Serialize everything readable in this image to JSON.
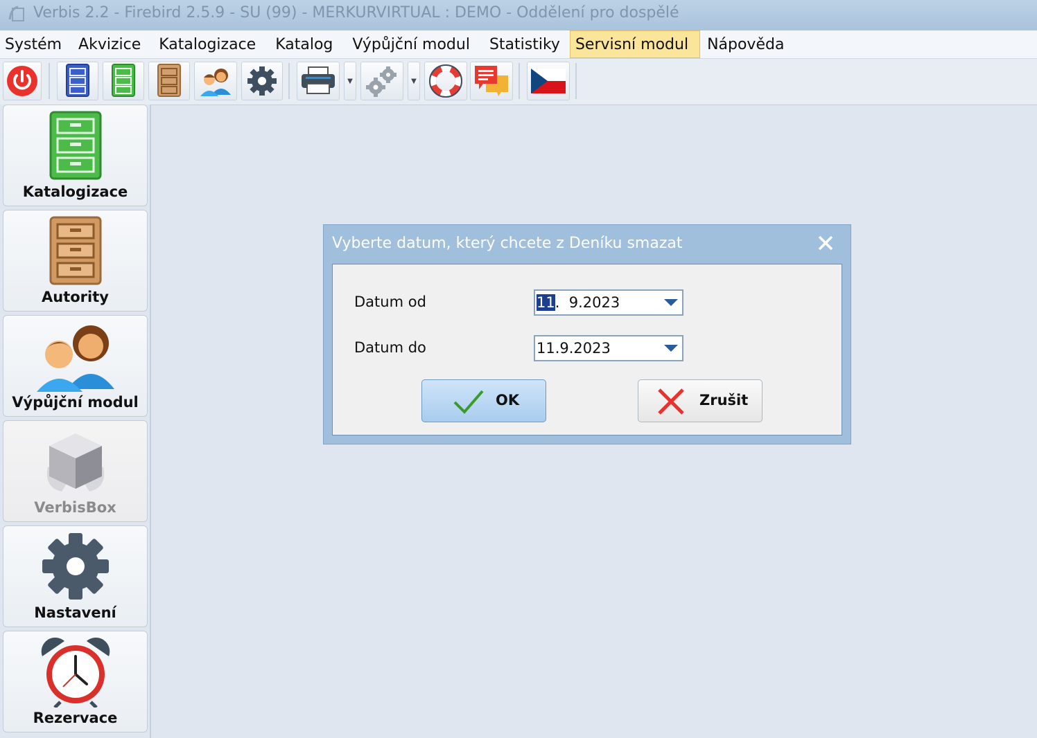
{
  "window": {
    "title": "Verbis 2.2 - Firebird 2.5.9 - SU (99) - MERKURVIRTUAL : DEMO - Oddělení pro dospělé"
  },
  "menu": [
    {
      "label": "Systém"
    },
    {
      "label": "Akvizice"
    },
    {
      "label": "Katalogizace"
    },
    {
      "label": "Katalog"
    },
    {
      "label": "Výpůjční modul"
    },
    {
      "label": "Statistiky"
    },
    {
      "label": "Servisní modul",
      "active": true
    },
    {
      "label": "Nápověda"
    }
  ],
  "toolbar": {
    "icons": [
      "power-icon",
      "blue-cabinet-icon",
      "green-cabinet-icon",
      "brown-cabinet-icon",
      "people-icon",
      "gear-icon",
      "printer-icon",
      "gears-icon",
      "lifebuoy-icon",
      "chat-icon",
      "czech-flag-icon"
    ]
  },
  "sidebar": {
    "items": [
      {
        "label": "Katalogizace",
        "icon": "green-cabinet-icon"
      },
      {
        "label": "Autority",
        "icon": "brown-cabinet-icon"
      },
      {
        "label": "Výpůjční modul",
        "icon": "people-icon"
      },
      {
        "label": "VerbisBox",
        "icon": "box-icon",
        "disabled": true
      },
      {
        "label": "Nastavení",
        "icon": "gear-icon"
      },
      {
        "label": "Rezervace",
        "icon": "alarm-clock-icon"
      }
    ]
  },
  "dialog": {
    "title": "Vyberte datum, který chcete z Deníku smazat",
    "date_from": {
      "label": "Datum od",
      "selected_part": "11",
      "rest": ".  9.2023"
    },
    "date_to": {
      "label": "Datum do",
      "value": "11.9.2023"
    },
    "ok_label": "OK",
    "cancel_label": "Zrušit"
  },
  "colors": {
    "accent": "#a9cdef",
    "menu_active": "#fbe59a",
    "dialog_frame": "#9fbfdc"
  }
}
